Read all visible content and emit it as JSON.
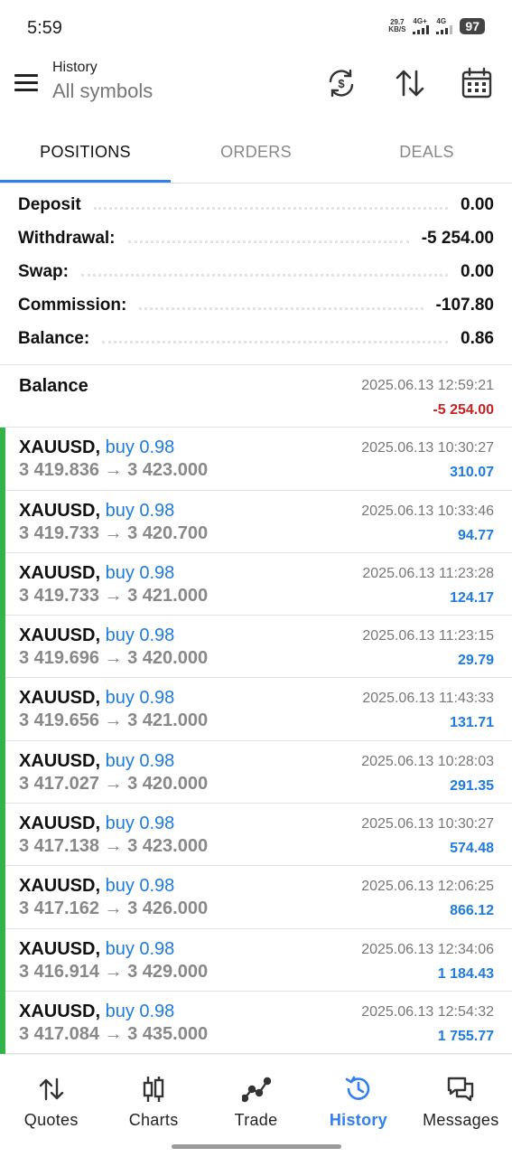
{
  "status_bar": {
    "time": "5:59",
    "net_speed_value": "29.7",
    "net_speed_unit": "KB/S",
    "sim1_label": "4G+",
    "sim2_label": "4G",
    "battery": "97"
  },
  "header": {
    "title": "History",
    "subtitle": "All symbols",
    "icons": [
      "sync-currency-icon",
      "sort-icon",
      "calendar-icon"
    ]
  },
  "tabs": [
    {
      "label": "POSITIONS",
      "active": true
    },
    {
      "label": "ORDERS",
      "active": false
    },
    {
      "label": "DEALS",
      "active": false
    }
  ],
  "summary": [
    {
      "label": "Deposit",
      "value": "0.00"
    },
    {
      "label": "Withdrawal:",
      "value": "-5 254.00"
    },
    {
      "label": "Swap:",
      "value": "0.00"
    },
    {
      "label": "Commission:",
      "value": "-107.80"
    },
    {
      "label": "Balance:",
      "value": "0.86"
    }
  ],
  "balance_entry": {
    "title": "Balance",
    "datetime": "2025.06.13 12:59:21",
    "amount": "-5 254.00"
  },
  "positions": [
    {
      "symbol": "XAUUSD,",
      "side": "buy 0.98",
      "prices": "3 419.836 → 3 423.000",
      "datetime": "2025.06.13 10:30:27",
      "profit": "310.07"
    },
    {
      "symbol": "XAUUSD,",
      "side": "buy 0.98",
      "prices": "3 419.733 → 3 420.700",
      "datetime": "2025.06.13 10:33:46",
      "profit": "94.77"
    },
    {
      "symbol": "XAUUSD,",
      "side": "buy 0.98",
      "prices": "3 419.733 → 3 421.000",
      "datetime": "2025.06.13 11:23:28",
      "profit": "124.17"
    },
    {
      "symbol": "XAUUSD,",
      "side": "buy 0.98",
      "prices": "3 419.696 → 3 420.000",
      "datetime": "2025.06.13 11:23:15",
      "profit": "29.79"
    },
    {
      "symbol": "XAUUSD,",
      "side": "buy 0.98",
      "prices": "3 419.656 → 3 421.000",
      "datetime": "2025.06.13 11:43:33",
      "profit": "131.71"
    },
    {
      "symbol": "XAUUSD,",
      "side": "buy 0.98",
      "prices": "3 417.027 → 3 420.000",
      "datetime": "2025.06.13 10:28:03",
      "profit": "291.35"
    },
    {
      "symbol": "XAUUSD,",
      "side": "buy 0.98",
      "prices": "3 417.138 → 3 423.000",
      "datetime": "2025.06.13 10:30:27",
      "profit": "574.48"
    },
    {
      "symbol": "XAUUSD,",
      "side": "buy 0.98",
      "prices": "3 417.162 → 3 426.000",
      "datetime": "2025.06.13 12:06:25",
      "profit": "866.12"
    },
    {
      "symbol": "XAUUSD,",
      "side": "buy 0.98",
      "prices": "3 416.914 → 3 429.000",
      "datetime": "2025.06.13 12:34:06",
      "profit": "1 184.43"
    },
    {
      "symbol": "XAUUSD,",
      "side": "buy 0.98",
      "prices": "3 417.084 → 3 435.000",
      "datetime": "2025.06.13 12:54:32",
      "profit": "1 755.77"
    }
  ],
  "bottom_nav": [
    {
      "label": "Quotes",
      "icon": "quotes-icon",
      "active": false
    },
    {
      "label": "Charts",
      "icon": "charts-icon",
      "active": false
    },
    {
      "label": "Trade",
      "icon": "trade-icon",
      "active": false
    },
    {
      "label": "History",
      "icon": "history-icon",
      "active": true
    },
    {
      "label": "Messages",
      "icon": "messages-icon",
      "active": false
    }
  ],
  "colors": {
    "accent": "#2f7ef2",
    "profit": "#1e7be0",
    "loss": "#cc1f1f",
    "buy_bar": "#34b34a"
  }
}
